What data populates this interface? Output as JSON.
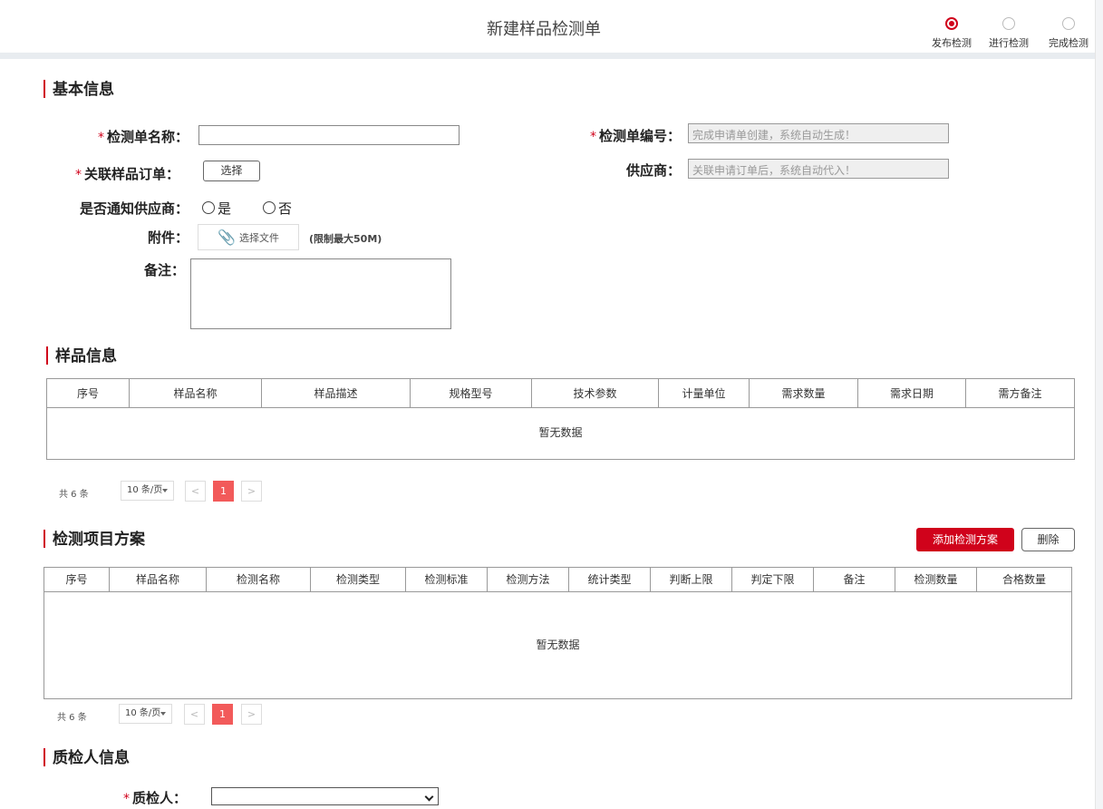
{
  "page": {
    "title": "新建样品检测单"
  },
  "steps": [
    {
      "label": "发布检测",
      "active": true
    },
    {
      "label": "进行检测",
      "active": false
    },
    {
      "label": "完成检测",
      "active": false
    }
  ],
  "basic": {
    "heading": "基本信息",
    "name_label": "检测单名称：",
    "code_label": "检测单编号：",
    "code_placeholder": "完成申请单创建，系统自动生成！",
    "order_label": "关联样品订单：",
    "select_btn": "选择",
    "supplier_label": "供应商：",
    "supplier_placeholder": "关联申请订单后，系统自动代入！",
    "notify_label": "是否通知供应商：",
    "notify_yes": "是",
    "notify_no": "否",
    "attach_label": "附件：",
    "attach_btn": "选择文件",
    "attach_hint": "(限制最大50M)",
    "remark_label": "备注："
  },
  "sample": {
    "heading": "样品信息",
    "columns": [
      "序号",
      "样品名称",
      "样品描述",
      "规格型号",
      "技术参数",
      "计量单位",
      "需求数量",
      "需求日期",
      "需方备注"
    ],
    "empty": "暂无数据",
    "pager": {
      "total": "共 6 条",
      "size": "10 条/页",
      "prev": "<",
      "page": "1",
      "next": ">"
    }
  },
  "plan": {
    "heading": "检测项目方案",
    "add_btn": "添加检测方案",
    "delete_btn": "删除",
    "columns": [
      "序号",
      "样品名称",
      "检测名称",
      "检测类型",
      "检测标准",
      "检测方法",
      "统计类型",
      "判断上限",
      "判定下限",
      "备注",
      "检测数量",
      "合格数量"
    ],
    "empty": "暂无数据",
    "pager": {
      "total": "共 6 条",
      "size": "10 条/页",
      "prev": "<",
      "page": "1",
      "next": ">"
    }
  },
  "inspector": {
    "heading": "质检人信息",
    "label": "质检人："
  },
  "colors": {
    "accent": "#d0021b",
    "page_active": "#f25a5a"
  }
}
